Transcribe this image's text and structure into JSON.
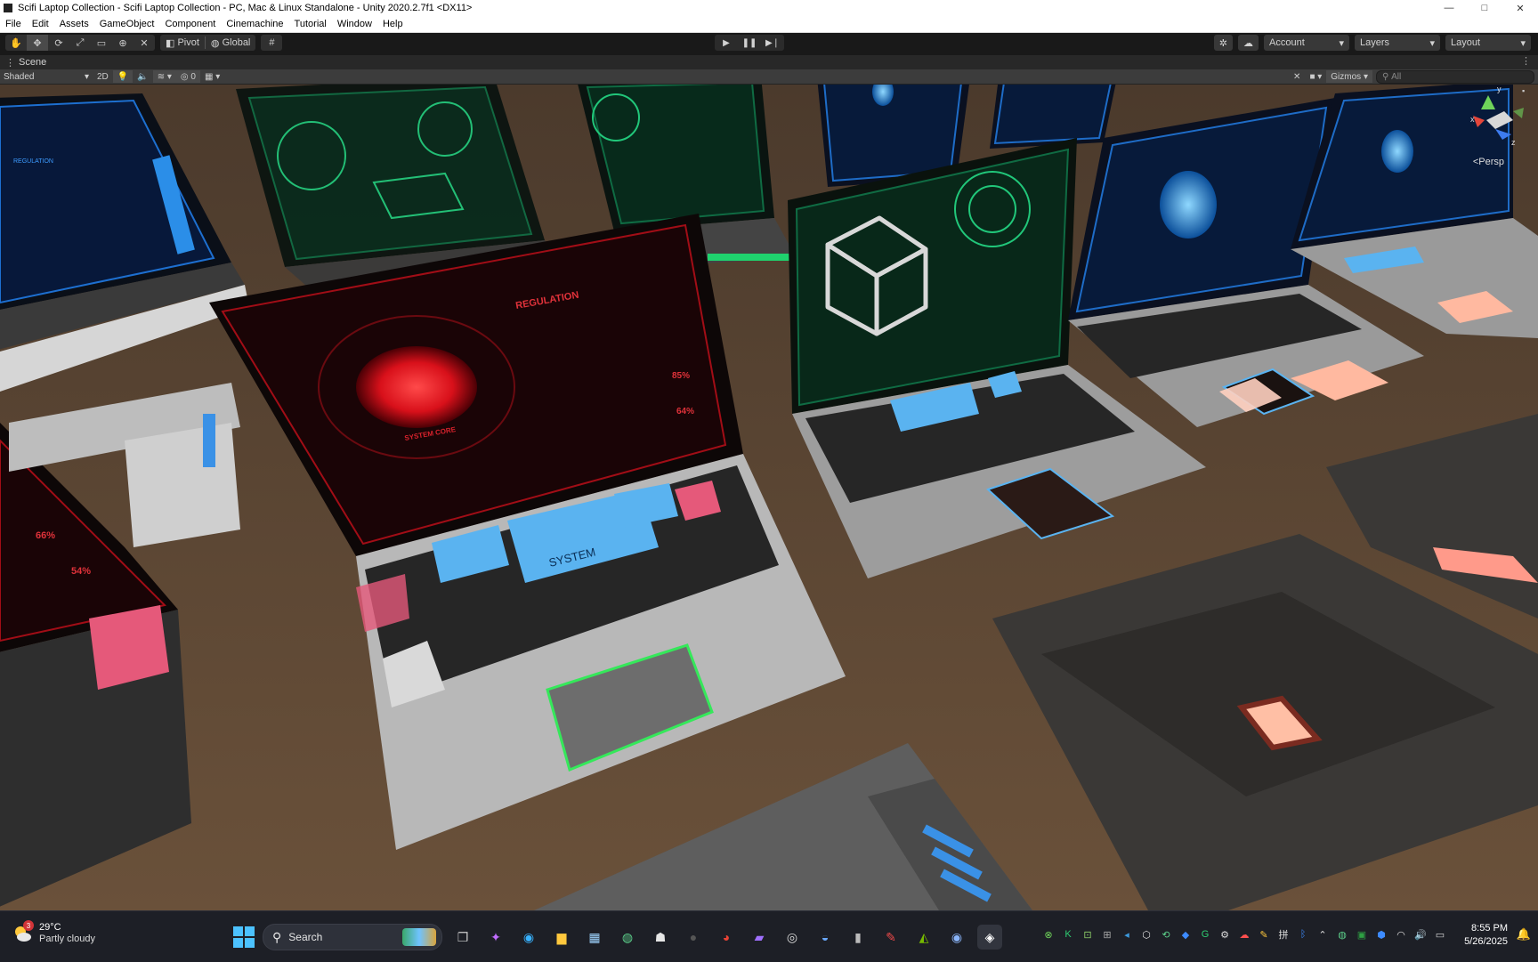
{
  "window": {
    "title": "Scifi Laptop Collection - Scifi Laptop Collection - PC, Mac & Linux Standalone - Unity 2020.2.7f1 <DX11>",
    "controls": [
      "—",
      "□",
      "✕"
    ]
  },
  "menu": [
    "File",
    "Edit",
    "Assets",
    "GameObject",
    "Component",
    "Cinemachine",
    "Tutorial",
    "Window",
    "Help"
  ],
  "toolbar": {
    "pivot_label": "Pivot",
    "global_label": "Global",
    "account_label": "Account",
    "layers_label": "Layers",
    "layout_label": "Layout"
  },
  "scene": {
    "tab_label": "Scene",
    "shading_mode": "Shaded",
    "mode_2d": "2D",
    "hidden_count": "0",
    "gizmos_label": "Gizmos",
    "search_placeholder": "All",
    "projection_label": "<Persp",
    "gizmo_axes": {
      "x": "x",
      "y": "y",
      "z": "z"
    }
  },
  "scene_art": {
    "red_screen_title": "REGULATION",
    "red_screen_core": "SYSTEM CORE",
    "red_screen_pct1": "85%",
    "red_screen_pct2": "64%",
    "left_screen_pct1": "66%",
    "left_screen_pct2": "54%",
    "keypad_system": "SYSTEM",
    "blue_screen_title": "REGULATION"
  },
  "taskbar": {
    "weather_temp": "29°C",
    "weather_condition": "Partly cloudy",
    "weather_badge": "3",
    "search_label": "Search",
    "time": "8:55 PM",
    "date": "5/26/2025"
  }
}
